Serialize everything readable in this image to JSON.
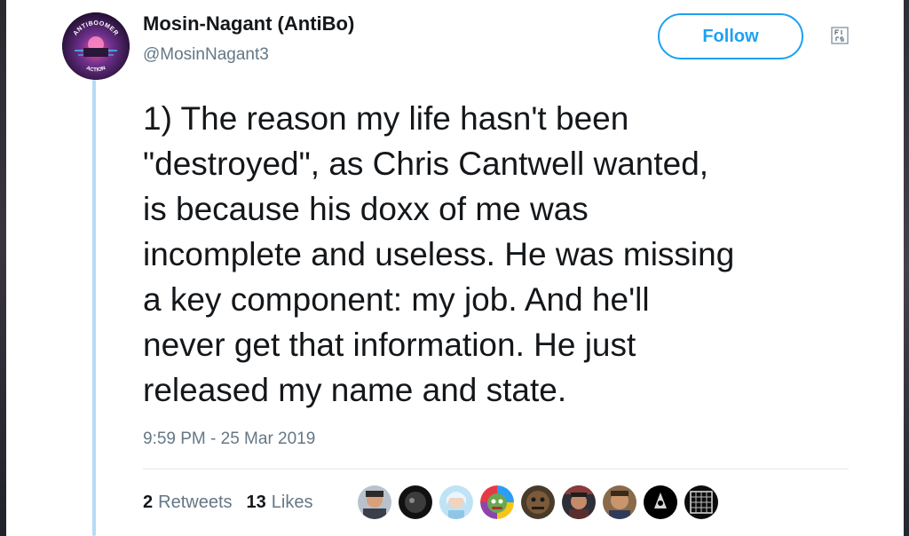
{
  "tweet": {
    "display_name": "Mosin-Nagant (AntiBo)",
    "handle": "@MosinNagant3",
    "follow_label": "Follow",
    "text": "1) The reason my life hasn't been\n\"destroyed\", as Chris Cantwell wanted,\nis because his doxx of me was\nincomplete and useless. He was missing\na key component: my job. And he'll\nnever get that information. He just\nreleased my name and state.",
    "timestamp": "9:59 PM - 25 Mar 2019",
    "avatar_text_top": "ANTIBOOMER",
    "avatar_text_bottom": "ACTION"
  },
  "stats": {
    "retweets_count": "2",
    "retweets_label": "Retweets",
    "likes_count": "13",
    "likes_label": "Likes"
  },
  "icons": {
    "caret": "chevron-down-icon"
  },
  "colors": {
    "accent": "#1da1f2",
    "thread_line": "#b5dcf7",
    "secondary_text": "#657786",
    "primary_text": "#14171a"
  }
}
